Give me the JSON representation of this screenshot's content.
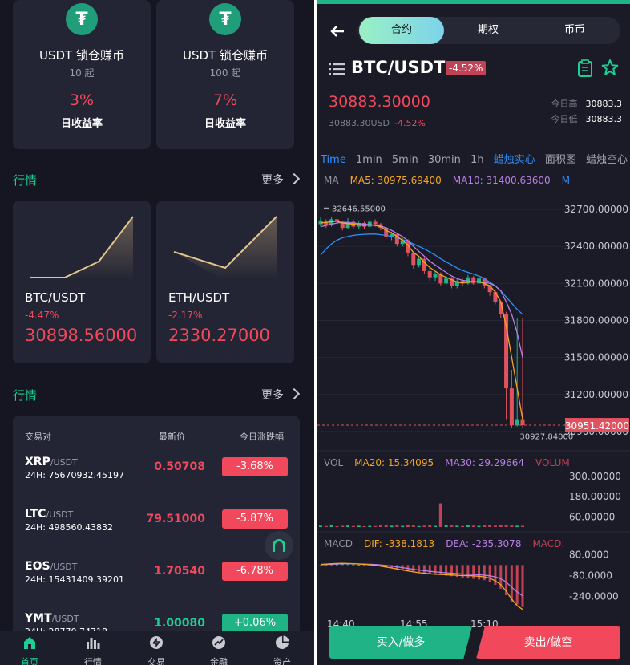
{
  "lock_cards": [
    {
      "icon": "tether-icon",
      "title": "USDT 锁仓赚币",
      "min": "10 起",
      "rate": "3%",
      "rate_label": "日收益率"
    },
    {
      "icon": "tether-icon",
      "title": "USDT 锁仓赚币",
      "min": "100 起",
      "rate": "7%",
      "rate_label": "日收益率"
    }
  ],
  "market_section": {
    "title": "行情",
    "more": "更多"
  },
  "mini_cards": [
    {
      "pair": "BTC/USDT",
      "change": "-4.47%",
      "price": "30898.56000",
      "spark": [
        0.95,
        0.95,
        0.7,
        0.0
      ]
    },
    {
      "pair": "ETH/USDT",
      "change": "-2.17%",
      "price": "2330.27000",
      "spark": [
        0.55,
        0.8,
        0.0
      ]
    }
  ],
  "quotes_section": {
    "title": "行情",
    "more": "更多"
  },
  "quote_table": {
    "headers": [
      "交易对",
      "最新价",
      "今日涨跌幅"
    ],
    "rows": [
      {
        "base": "XRP",
        "quote": "/USDT",
        "vol": "24H: 75670932.45197",
        "price": "0.50708",
        "change": "-3.68%",
        "up": false
      },
      {
        "base": "LTC",
        "quote": "/USDT",
        "vol": "24H: 498560.43832",
        "price": "79.51000",
        "change": "-5.87%",
        "up": false
      },
      {
        "base": "EOS",
        "quote": "/USDT",
        "vol": "24H: 15431409.39201",
        "price": "1.70540",
        "change": "-6.78%",
        "up": false
      },
      {
        "base": "YMT",
        "quote": "/USDT",
        "vol": "24H: 28770.74718",
        "price": "1.00080",
        "change": "+0.06%",
        "up": true
      }
    ]
  },
  "tabbar": [
    {
      "label": "首页",
      "icon": "home-icon",
      "active": true
    },
    {
      "label": "行情",
      "icon": "bar-chart-icon",
      "active": false
    },
    {
      "label": "交易",
      "icon": "exchange-icon",
      "active": false
    },
    {
      "label": "金融",
      "icon": "trend-icon",
      "active": false
    },
    {
      "label": "资产",
      "icon": "pie-icon",
      "active": false
    }
  ],
  "trade": {
    "segments": [
      "合约",
      "期权",
      "币币"
    ],
    "active_segment": 0,
    "pair": "BTC/USDT",
    "pair_change": "-4.52%",
    "last_price": "30883.30000",
    "sub_price": "30883.30USD",
    "sub_change": "-4.52%",
    "high_label": "今日高",
    "high": "30883.3",
    "low_label": "今日低",
    "low": "30883.3",
    "intervals": [
      "Time",
      "1min",
      "5min",
      "30min",
      "1h",
      "蜡烛实心",
      "面积图",
      "蜡烛空心",
      "蜡"
    ],
    "interval_active": [
      0,
      5
    ],
    "ma_line": [
      "MA",
      "MA5: 30975.69400",
      "MA10: 31400.63600",
      "M"
    ],
    "vol_line": [
      "VOL",
      "MA20: 15.34095",
      "MA30: 29.29664",
      "VOLUM"
    ],
    "macd_line": [
      "MACD",
      "DIF: -338.1813",
      "DEA: -235.3078",
      "MACD:"
    ],
    "buy_label": "买入/做多",
    "sell_label": "卖出/做空"
  },
  "chart_data": {
    "type": "candlestick",
    "price_axis": [
      "32700.00000",
      "32400.00000",
      "32100.00000",
      "31800.00000",
      "31500.00000",
      "31200.00000",
      "30900.00000"
    ],
    "price_range": [
      30880,
      32720
    ],
    "max_marker": "32646.55000",
    "min_marker": "30927.84000",
    "current_price_tag": "30951.42000",
    "current_price": 30951.42,
    "vol_axis": [
      "300.00000",
      "180.00000",
      "60.00000"
    ],
    "macd_axis": [
      "80.0000",
      "-80.0000",
      "-240.0000"
    ],
    "time_labels": [
      "14:40",
      "14:55",
      "15:10"
    ],
    "candles": [
      [
        32580,
        32610,
        32560,
        32640
      ],
      [
        32600,
        32570,
        32550,
        32620
      ],
      [
        32570,
        32620,
        32560,
        32640
      ],
      [
        32620,
        32600,
        32580,
        32646.55
      ],
      [
        32600,
        32550,
        32530,
        32610
      ],
      [
        32550,
        32600,
        32540,
        32630
      ],
      [
        32600,
        32560,
        32540,
        32620
      ],
      [
        32560,
        32590,
        32540,
        32610
      ],
      [
        32590,
        32560,
        32540,
        32600
      ],
      [
        32560,
        32600,
        32550,
        32620
      ],
      [
        32600,
        32580,
        32560,
        32620
      ],
      [
        32580,
        32550,
        32530,
        32590
      ],
      [
        32550,
        32480,
        32460,
        32560
      ],
      [
        32480,
        32500,
        32450,
        32520
      ],
      [
        32500,
        32420,
        32400,
        32510
      ],
      [
        32420,
        32450,
        32400,
        32470
      ],
      [
        32450,
        32350,
        32320,
        32460
      ],
      [
        32350,
        32250,
        32220,
        32360
      ],
      [
        32250,
        32300,
        32230,
        32320
      ],
      [
        32300,
        32200,
        32180,
        32310
      ],
      [
        32200,
        32150,
        32120,
        32230
      ],
      [
        32150,
        32180,
        32120,
        32200
      ],
      [
        32180,
        32100,
        32080,
        32190
      ],
      [
        32100,
        32140,
        32080,
        32160
      ],
      [
        32140,
        32080,
        32060,
        32150
      ],
      [
        32080,
        32120,
        32060,
        32140
      ],
      [
        32120,
        32100,
        32080,
        32140
      ],
      [
        32100,
        32150,
        32090,
        32170
      ],
      [
        32150,
        32100,
        32090,
        32160
      ],
      [
        32100,
        32140,
        32080,
        32160
      ],
      [
        32140,
        32080,
        32060,
        32150
      ],
      [
        32080,
        32030,
        32000,
        32090
      ],
      [
        32030,
        31950,
        31930,
        32040
      ],
      [
        31950,
        31850,
        31820,
        31960
      ],
      [
        31850,
        31250,
        31000,
        31870
      ],
      [
        31250,
        30950,
        30927.84,
        31400
      ],
      [
        30950,
        31000,
        30940,
        31820
      ],
      [
        31000,
        30951.42,
        30930,
        31820
      ]
    ],
    "ma5": [
      32590,
      32595,
      32600,
      32605,
      32590,
      32585,
      32580,
      32575,
      32570,
      32575,
      32570,
      32560,
      32530,
      32510,
      32480,
      32450,
      32410,
      32350,
      32320,
      32270,
      32230,
      32200,
      32170,
      32150,
      32130,
      32110,
      32105,
      32110,
      32115,
      32115,
      32100,
      32080,
      32030,
      31950,
      31750,
      31500,
      31250,
      31000
    ],
    "ma10": [
      32560,
      32570,
      32580,
      32590,
      32595,
      32592,
      32590,
      32585,
      32580,
      32576,
      32572,
      32565,
      32550,
      32530,
      32505,
      32480,
      32445,
      32400,
      32360,
      32320,
      32280,
      32250,
      32220,
      32190,
      32160,
      32140,
      32125,
      32120,
      32115,
      32115,
      32110,
      32100,
      32080,
      32040,
      31950,
      31850,
      31700,
      31500
    ],
    "ma_long": [
      32330,
      32380,
      32420,
      32450,
      32470,
      32480,
      32490,
      32495,
      32498,
      32500,
      32500,
      32495,
      32490,
      32480,
      32470,
      32455,
      32440,
      32420,
      32400,
      32380,
      32355,
      32330,
      32300,
      32275,
      32250,
      32225,
      32205,
      32190,
      32175,
      32160,
      32140,
      32110,
      32080,
      32040,
      31990,
      31940,
      31890,
      31850
    ],
    "volumes": [
      8,
      6,
      10,
      5,
      7,
      9,
      6,
      8,
      5,
      7,
      6,
      9,
      12,
      8,
      10,
      7,
      11,
      9,
      6,
      8,
      10,
      7,
      140,
      12,
      9,
      8,
      6,
      10,
      8,
      7,
      9,
      11,
      8,
      10,
      12,
      9,
      8,
      7
    ],
    "macd": [
      -10,
      -5,
      0,
      5,
      8,
      6,
      4,
      2,
      0,
      -2,
      -5,
      -10,
      -20,
      -25,
      -30,
      -35,
      -40,
      -50,
      -55,
      -60,
      -65,
      -70,
      -75,
      -80,
      -85,
      -90,
      -95,
      -100,
      -105,
      -110,
      -115,
      -130,
      -150,
      -180,
      -230,
      -280,
      -300,
      -320
    ],
    "dif": [
      5,
      8,
      10,
      12,
      13,
      12,
      10,
      8,
      5,
      2,
      -2,
      -8,
      -15,
      -22,
      -30,
      -38,
      -45,
      -52,
      -58,
      -62,
      -66,
      -70,
      -72,
      -74,
      -76,
      -78,
      -80,
      -80,
      -82,
      -85,
      -90,
      -100,
      -120,
      -150,
      -200,
      -260,
      -310,
      -338.18
    ],
    "dea": [
      2,
      4,
      6,
      8,
      10,
      10,
      10,
      9,
      8,
      6,
      4,
      1,
      -3,
      -8,
      -14,
      -20,
      -26,
      -32,
      -38,
      -43,
      -48,
      -52,
      -56,
      -59,
      -62,
      -65,
      -68,
      -70,
      -72,
      -74,
      -77,
      -82,
      -90,
      -105,
      -130,
      -170,
      -205,
      -235.31
    ]
  }
}
